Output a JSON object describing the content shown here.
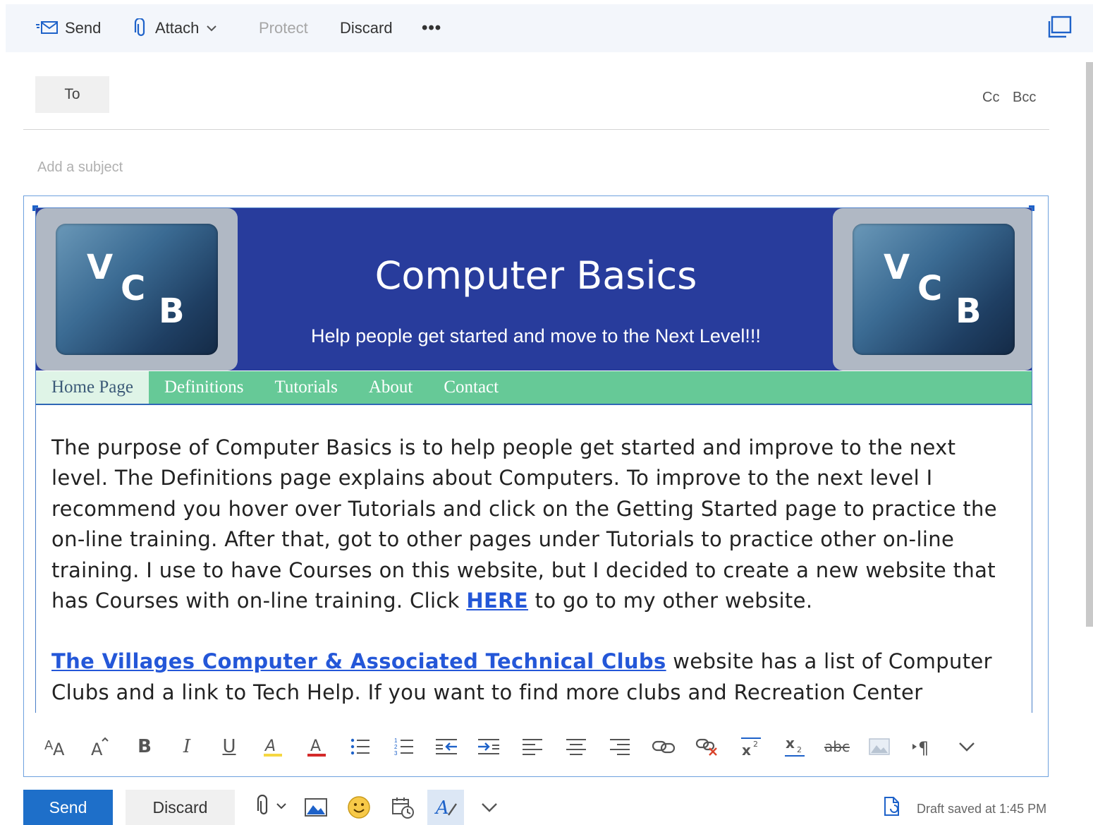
{
  "toolbar": {
    "send_label": "Send",
    "attach_label": "Attach",
    "protect_label": "Protect",
    "discard_label": "Discard",
    "more_label": "•••"
  },
  "recipients": {
    "to_label": "To",
    "cc_label": "Cc",
    "bcc_label": "Bcc"
  },
  "subject": {
    "placeholder": "Add a subject",
    "value": ""
  },
  "banner": {
    "logo_letters": [
      "V",
      "C",
      "B"
    ],
    "title": "Computer Basics",
    "subtitle": "Help people get started and move to the Next Level!!!",
    "background_color": "#283c9c"
  },
  "nav": {
    "items": [
      {
        "label": "Home Page",
        "active": true
      },
      {
        "label": "Definitions",
        "active": false
      },
      {
        "label": "Tutorials",
        "active": false
      },
      {
        "label": "About",
        "active": false
      },
      {
        "label": "Contact",
        "active": false
      }
    ],
    "color": "#66c997"
  },
  "body": {
    "para1_before_link": "The purpose of Computer Basics is to help people get started and improve to the next level.  The Definitions page explains about Computers.  To improve to the next level I recommend you hover over Tutorials and click on the Getting Started page to practice the on-line training.  After that, got to other pages under Tutorials to practice other on-line training.  I use to have Courses on this website, but I decided to create a new website that has Courses with on-line training.  Click ",
    "para1_link": "HERE",
    "para1_after_link": " to go to my other website.",
    "para2_link": "The Villages Computer & Associated Technical Clubs",
    "para2_text": " website has a list of Computer Clubs and a link to Tech Help.  If you want to find more clubs and Recreation Center"
  },
  "format_toolbar": {
    "icons": [
      "font-size-icon",
      "grow-font-icon",
      "bold-icon",
      "italic-icon",
      "underline-icon",
      "highlight-icon",
      "font-color-icon",
      "bullets-icon",
      "numbering-icon",
      "decrease-indent-icon",
      "increase-indent-icon",
      "align-left-icon",
      "align-center-icon",
      "align-right-icon",
      "insert-link-icon",
      "remove-link-icon",
      "superscript-icon",
      "subscript-icon",
      "strikethrough-icon",
      "insert-image-icon",
      "paragraph-direction-icon",
      "more-options-icon"
    ],
    "labels": {
      "bold": "B",
      "italic": "I",
      "underline": "U",
      "strike": "abc",
      "para": "¶"
    }
  },
  "bottom": {
    "send_label": "Send",
    "discard_label": "Discard",
    "draft_status": "Draft saved at 1:45 PM",
    "accent": "#1e6fc9"
  }
}
